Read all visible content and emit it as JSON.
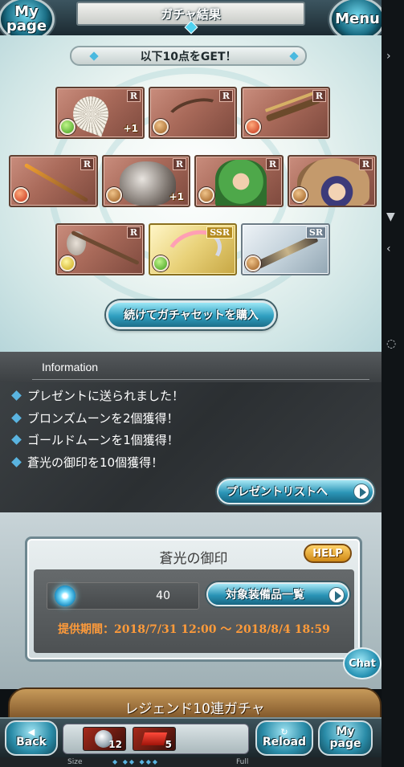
{
  "header": {
    "title": "ガチャ結果",
    "left_button": "My page",
    "right_button": "Menu"
  },
  "result": {
    "banner": "以下10点をGET！",
    "cards": [
      {
        "rarity": "R",
        "element": "wind",
        "plus": "+1",
        "icon": "fan-weapon-icon"
      },
      {
        "rarity": "R",
        "element": "earth",
        "plus": "",
        "icon": "bow-weapon-icon"
      },
      {
        "rarity": "R",
        "element": "fire",
        "plus": "",
        "icon": "crossbow-weapon-icon"
      },
      {
        "rarity": "R",
        "element": "fire",
        "plus": "",
        "icon": "staff-weapon-icon"
      },
      {
        "rarity": "R",
        "element": "earth",
        "plus": "+1",
        "icon": "beast-summon-icon"
      },
      {
        "rarity": "R",
        "element": "earth",
        "plus": "",
        "icon": "green-haired-character-icon"
      },
      {
        "rarity": "R",
        "element": "earth",
        "plus": "",
        "icon": "mage-character-icon"
      },
      {
        "rarity": "R",
        "element": "light",
        "plus": "",
        "icon": "axe-weapon-icon"
      },
      {
        "rarity": "SSR",
        "element": "wind",
        "plus": "",
        "icon": "ssr-blade-weapon-icon"
      },
      {
        "rarity": "SR",
        "element": "earth",
        "plus": "",
        "icon": "sr-gun-weapon-icon"
      }
    ],
    "buy_button": "続けてガチャセットを購入"
  },
  "information": {
    "title": "Information",
    "items": [
      "プレゼントに送られました！",
      "ブロンズムーンを2個獲得！",
      "ゴールドムーンを1個獲得！",
      "蒼光の御印を10個獲得！"
    ],
    "present_button": "プレゼントリストへ"
  },
  "seal": {
    "title": "蒼光の御印",
    "help_button": "HELP",
    "count": "40",
    "equip_button": "対象装備品一覧",
    "period": "提供期間：2018/7/31 12:00 〜 2018/8/4 18:59"
  },
  "chat_button": "Chat",
  "legend_banner": "レジェンド10連ガチャ",
  "bottom_bar": {
    "back": "Back",
    "reload": "Reload",
    "mypage": "My page",
    "tray": [
      {
        "icon": "silver-orb-icon",
        "count": "12"
      },
      {
        "icon": "red-ticket-icon",
        "count": "5"
      }
    ]
  },
  "size_bar": {
    "size_label": "Size",
    "full_label": "Full"
  }
}
